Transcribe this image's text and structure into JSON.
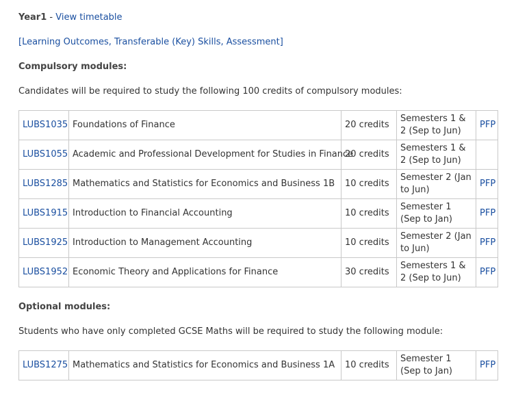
{
  "year": {
    "label": "Year1",
    "separator": " - ",
    "timetable_link": "View timetable"
  },
  "outcomes_link": "[Learning Outcomes, Transferable (Key) Skills, Assessment]",
  "compulsory": {
    "heading": "Compulsory modules:",
    "intro": "Candidates will be required to study the following 100 credits of compulsory modules:",
    "modules": [
      {
        "code": "LUBS1035",
        "title": "Foundations of Finance",
        "credits": "20 credits",
        "semester": "Semesters 1 & 2 (Sep to Jun)",
        "pfp": "PFP"
      },
      {
        "code": "LUBS1055",
        "title": "Academic and Professional Development for Studies in Finance",
        "credits": "20 credits",
        "semester": "Semesters 1 & 2 (Sep to Jun)",
        "pfp": ""
      },
      {
        "code": "LUBS1285",
        "title": "Mathematics and Statistics for Economics and Business 1B",
        "credits": "10 credits",
        "semester": "Semester 2 (Jan to Jun)",
        "pfp": "PFP"
      },
      {
        "code": "LUBS1915",
        "title": "Introduction to Financial Accounting",
        "credits": "10 credits",
        "semester": "Semester 1 (Sep to Jan)",
        "pfp": "PFP"
      },
      {
        "code": "LUBS1925",
        "title": "Introduction to Management Accounting",
        "credits": "10 credits",
        "semester": "Semester 2 (Jan to Jun)",
        "pfp": "PFP"
      },
      {
        "code": "LUBS1952",
        "title": "Economic Theory and Applications for Finance",
        "credits": "30 credits",
        "semester": "Semesters 1 & 2 (Sep to Jun)",
        "pfp": "PFP"
      }
    ]
  },
  "optional": {
    "heading": "Optional modules:",
    "intro": "Students who have only completed GCSE Maths will be required to study the following module:",
    "modules": [
      {
        "code": "LUBS1275",
        "title": "Mathematics and Statistics for Economics and Business 1A",
        "credits": "10 credits",
        "semester": "Semester 1 (Sep to Jan)",
        "pfp": "PFP"
      }
    ]
  }
}
